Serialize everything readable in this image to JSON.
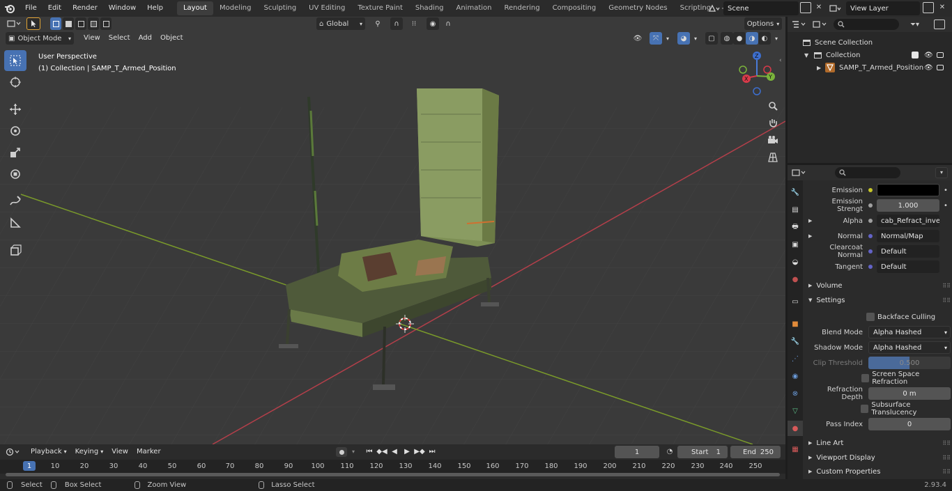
{
  "topbar": {
    "menus": [
      "File",
      "Edit",
      "Render",
      "Window",
      "Help"
    ],
    "workspaces": [
      "Layout",
      "Modeling",
      "Sculpting",
      "UV Editing",
      "Texture Paint",
      "Shading",
      "Animation",
      "Rendering",
      "Compositing",
      "Geometry Nodes",
      "Scripting"
    ],
    "active_workspace": "Layout",
    "scene": "Scene",
    "view_layer": "View Layer"
  },
  "viewport": {
    "mode": "Object Mode",
    "menus": [
      "View",
      "Select",
      "Add",
      "Object"
    ],
    "orientation": "Global",
    "options": "Options",
    "perspective_label": "User Perspective",
    "collection_label": "(1) Collection | SAMP_T_Armed_Position",
    "gizmo_axes": [
      "X",
      "Y",
      "Z"
    ]
  },
  "outliner": {
    "scene_collection": "Scene Collection",
    "collection": "Collection",
    "object": "SAMP_T_Armed_Position"
  },
  "properties": {
    "rows": {
      "emission": {
        "label": "Emission"
      },
      "emission_strength": {
        "label": "Emission Strengt",
        "value": "1.000"
      },
      "alpha": {
        "label": "Alpha",
        "value": "cab_Refract_invert.p..."
      },
      "normal": {
        "label": "Normal",
        "value": "Normal/Map"
      },
      "clearcoat_normal": {
        "label": "Clearcoat Normal",
        "value": "Default"
      },
      "tangent": {
        "label": "Tangent",
        "value": "Default"
      }
    },
    "sections": {
      "volume": "Volume",
      "settings": "Settings",
      "line_art": "Line Art",
      "viewport_display": "Viewport Display",
      "custom_properties": "Custom Properties"
    },
    "settings": {
      "backface_culling": "Backface Culling",
      "blend_mode_label": "Blend Mode",
      "blend_mode": "Alpha Hashed",
      "shadow_mode_label": "Shadow Mode",
      "shadow_mode": "Alpha Hashed",
      "clip_threshold_label": "Clip Threshold",
      "clip_threshold": "0.500",
      "screen_space_refraction": "Screen Space Refraction",
      "refraction_depth_label": "Refraction Depth",
      "refraction_depth": "0 m",
      "subsurface_translucency": "Subsurface Translucency",
      "pass_index_label": "Pass Index",
      "pass_index": "0"
    },
    "colors": {
      "emission_swatch": "#000000",
      "slider_fill": "#4772b3"
    }
  },
  "timeline": {
    "menus": [
      "Playback",
      "Keying",
      "View",
      "Marker"
    ],
    "current_frame": "1",
    "start_label": "Start",
    "start": "1",
    "end_label": "End",
    "end": "250",
    "ticks": [
      "1",
      "10",
      "20",
      "30",
      "40",
      "50",
      "60",
      "70",
      "80",
      "90",
      "100",
      "110",
      "120",
      "130",
      "140",
      "150",
      "160",
      "170",
      "180",
      "190",
      "200",
      "210",
      "220",
      "230",
      "240",
      "250"
    ]
  },
  "statusbar": {
    "select": "Select",
    "box_select": "Box Select",
    "zoom_view": "Zoom View",
    "lasso_select": "Lasso Select",
    "version": "2.93.4"
  }
}
